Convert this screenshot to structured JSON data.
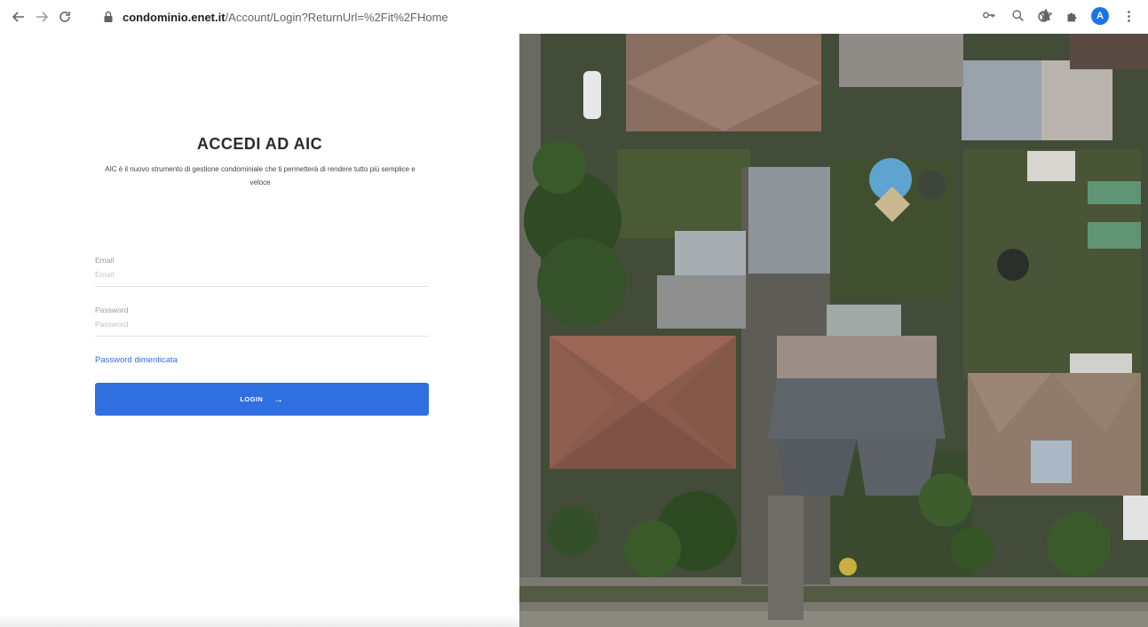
{
  "browser": {
    "url_host": "condominio.enet.it",
    "url_path": "/Account/Login?ReturnUrl=%2Fit%2FHome",
    "avatar_letter": "A",
    "icons": {
      "back": "arrow-left-icon",
      "forward": "arrow-right-icon",
      "reload": "reload-icon",
      "lock": "lock-icon",
      "key": "key-icon",
      "zoom": "magnifier-icon",
      "bookmark": "star-icon",
      "extension1": "circle-extension-icon",
      "extensions": "puzzle-icon",
      "menu": "kebab-menu-icon"
    }
  },
  "login": {
    "title": "ACCEDI AD AIC",
    "subtitle": "AIC è il nuovo strumento di gestione condominiale che ti permetterà di rendere tutto più semplice e veloce",
    "email_label": "Email",
    "email_placeholder": "Email",
    "email_value": "",
    "password_label": "Password",
    "password_placeholder": "Password",
    "password_value": "",
    "forgot_link": "Password dimenticata",
    "login_button": "LOGIN",
    "login_arrow": "→"
  },
  "colors": {
    "accent": "#2f6fe0",
    "chrome_avatar": "#1a73e8"
  }
}
